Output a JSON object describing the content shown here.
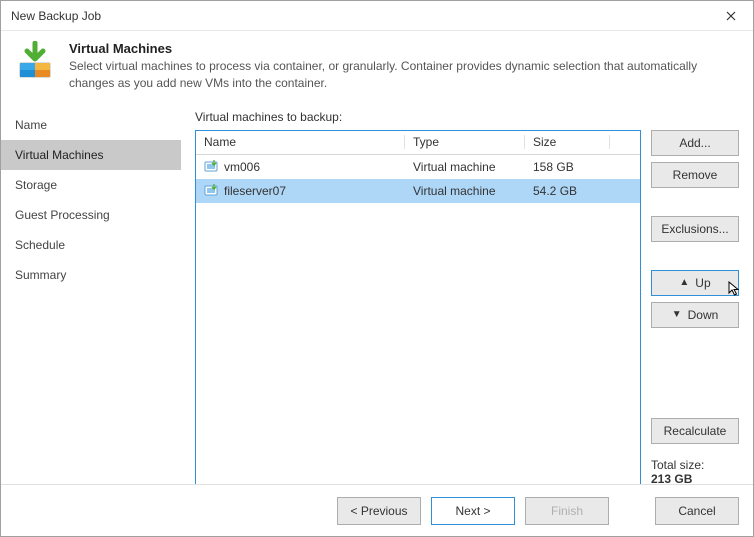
{
  "window_title": "New Backup Job",
  "header": {
    "title": "Virtual Machines",
    "description": "Select virtual machines to process via container, or granularly. Container provides dynamic selection that automatically changes as you add new VMs into the container."
  },
  "sidebar": {
    "items": [
      {
        "label": "Name",
        "active": false
      },
      {
        "label": "Virtual Machines",
        "active": true
      },
      {
        "label": "Storage",
        "active": false
      },
      {
        "label": "Guest Processing",
        "active": false
      },
      {
        "label": "Schedule",
        "active": false
      },
      {
        "label": "Summary",
        "active": false
      }
    ]
  },
  "main": {
    "label": "Virtual machines to backup:",
    "columns": {
      "name": "Name",
      "type": "Type",
      "size": "Size"
    },
    "rows": [
      {
        "name": "vm006",
        "type": "Virtual machine",
        "size": "158 GB",
        "selected": false
      },
      {
        "name": "fileserver07",
        "type": "Virtual machine",
        "size": "54.2 GB",
        "selected": true
      }
    ],
    "buttons": {
      "add": "Add...",
      "remove": "Remove",
      "exclusions": "Exclusions...",
      "up": "Up",
      "down": "Down",
      "recalculate": "Recalculate"
    },
    "total": {
      "label": "Total size:",
      "value": "213 GB"
    }
  },
  "footer": {
    "previous": "< Previous",
    "next": "Next >",
    "finish": "Finish",
    "cancel": "Cancel"
  }
}
